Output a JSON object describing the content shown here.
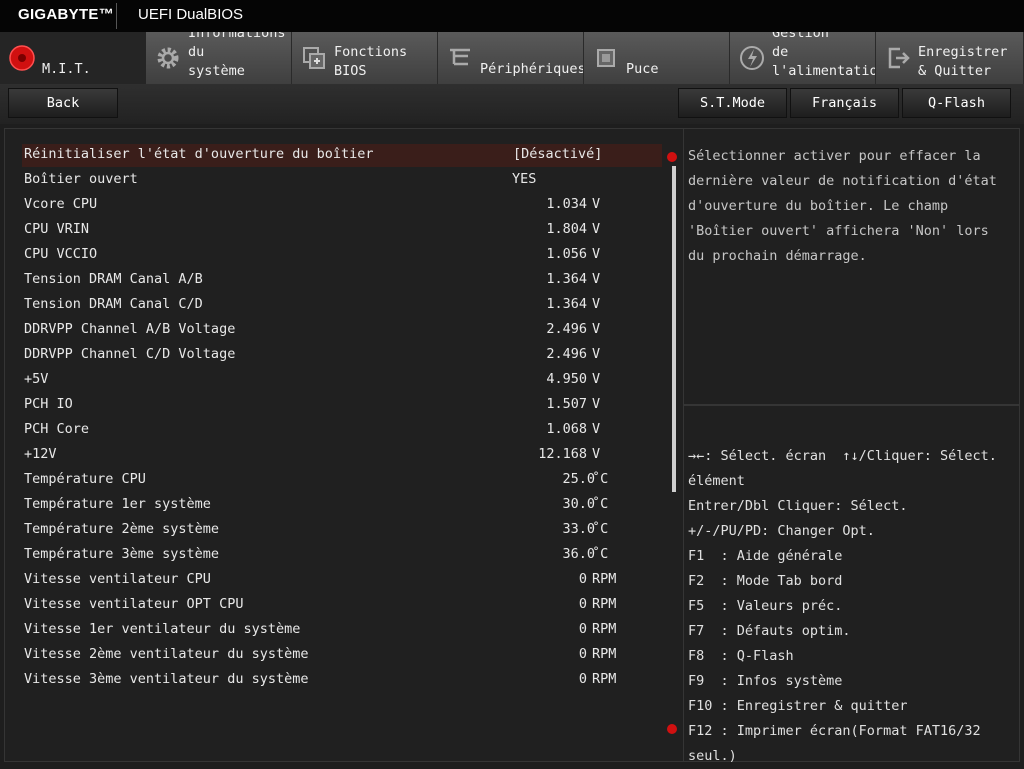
{
  "header": {
    "brand": "GIGABYTE™",
    "subtitle": "UEFI DualBIOS"
  },
  "tabs": [
    {
      "label": "M.I.T.",
      "icon": "mit-red-circle-icon"
    },
    {
      "label": "Informations\ndu\nsystème",
      "icon": "gear-icon"
    },
    {
      "label": "Fonctions\nBIOS",
      "icon": "bios-chip-icon"
    },
    {
      "label": "Périphériques",
      "icon": "peripherals-icon"
    },
    {
      "label": "Puce",
      "icon": "chip-icon"
    },
    {
      "label": "Gestion\nde\nl'alimentatio",
      "icon": "power-icon"
    },
    {
      "label": "Enregistrer\n& Quitter",
      "icon": "exit-icon"
    }
  ],
  "buttons": {
    "back": "Back",
    "stmode": "S.T.Mode",
    "language": "Français",
    "qflash": "Q-Flash"
  },
  "settings": [
    {
      "label": "Réinitialiser l'état d'ouverture du boîtier",
      "value": "[Désactivé]"
    },
    {
      "label": "Boîtier ouvert",
      "value": "YES"
    },
    {
      "label": "Vcore CPU",
      "value": "1.034",
      "unit": "V"
    },
    {
      "label": "CPU VRIN",
      "value": "1.804",
      "unit": "V"
    },
    {
      "label": "CPU VCCIO",
      "value": "1.056",
      "unit": "V"
    },
    {
      "label": "Tension DRAM Canal A/B",
      "value": "1.364",
      "unit": "V"
    },
    {
      "label": "Tension DRAM Canal C/D",
      "value": "1.364",
      "unit": "V"
    },
    {
      "label": "DDRVPP Channel A/B Voltage",
      "value": "2.496",
      "unit": "V"
    },
    {
      "label": "DDRVPP Channel C/D Voltage",
      "value": "2.496",
      "unit": "V"
    },
    {
      "label": "+5V",
      "value": "4.950",
      "unit": "V"
    },
    {
      "label": "PCH IO",
      "value": "1.507",
      "unit": "V"
    },
    {
      "label": "PCH Core",
      "value": "1.068",
      "unit": "V"
    },
    {
      "label": "+12V",
      "value": "12.168",
      "unit": "V"
    },
    {
      "label": "Température CPU",
      "value": "25.0",
      "unit": "˚C"
    },
    {
      "label": "Température 1er système",
      "value": "30.0",
      "unit": "˚C"
    },
    {
      "label": "Température 2ème système",
      "value": "33.0",
      "unit": "˚C"
    },
    {
      "label": "Température 3ème système",
      "value": "36.0",
      "unit": "˚C"
    },
    {
      "label": "Vitesse ventilateur CPU",
      "value": "0",
      "unit": "RPM"
    },
    {
      "label": "Vitesse ventilateur OPT CPU",
      "value": "0",
      "unit": "RPM"
    },
    {
      "label": "Vitesse 1er ventilateur du système",
      "value": "0",
      "unit": "RPM"
    },
    {
      "label": "Vitesse 2ème ventilateur du système",
      "value": "0",
      "unit": "RPM"
    },
    {
      "label": "Vitesse 3ème ventilateur du système",
      "value": "0",
      "unit": "RPM"
    }
  ],
  "help": "Sélectionner activer pour effacer la\ndernière valeur de notification d'état\nd'ouverture du boîtier. Le champ\n'Boîtier ouvert' affichera 'Non' lors\ndu prochain démarrage.",
  "keys": "→←: Sélect. écran  ↑↓/Cliquer: Sélect.\nélément\nEntrer/Dbl Cliquer: Sélect.\n+/-/PU/PD: Changer Opt.\nF1  : Aide générale\nF2  : Mode Tab bord\nF5  : Valeurs préc.\nF7  : Défauts optim.\nF8  : Q-Flash\nF9  : Infos système\nF10 : Enregistrer & quitter\nF12 : Imprimer écran(Format FAT16/32\nseul.)",
  "colors": {
    "accent": "#d01010",
    "selected_row": "#3a1e1a"
  }
}
